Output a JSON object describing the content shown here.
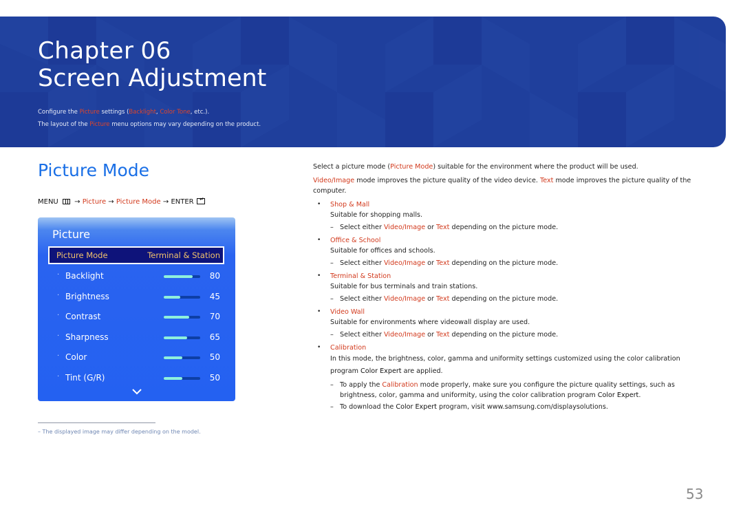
{
  "banner": {
    "chapter_label": "Chapter",
    "chapter_number": "06",
    "title": "Screen Adjustment",
    "desc1": {
      "p1": "Configure the ",
      "h1": "Picture",
      "p2": " settings (",
      "h2": "Backlight",
      "p3": ", ",
      "h3": "Color Tone",
      "p4": ", etc.)."
    },
    "desc2": {
      "p1": "The layout of the ",
      "h1": "Picture",
      "p2": " menu options may vary depending on the product."
    }
  },
  "section": {
    "title": "Picture Mode",
    "menu_path": {
      "menu": "MENU",
      "arrow": "→",
      "step1": "Picture",
      "step2": "Picture Mode",
      "enter": "ENTER"
    }
  },
  "osd": {
    "title": "Picture",
    "selected": {
      "label": "Picture Mode",
      "value": "Terminal & Station"
    },
    "rows": [
      {
        "label": "Backlight",
        "value": "80",
        "level": 80
      },
      {
        "label": "Brightness",
        "value": "45",
        "level": 45
      },
      {
        "label": "Contrast",
        "value": "70",
        "level": 70
      },
      {
        "label": "Sharpness",
        "value": "65",
        "level": 65
      },
      {
        "label": "Color",
        "value": "50",
        "level": 50
      },
      {
        "label": "Tint (G/R)",
        "value": "50",
        "level": 50
      }
    ],
    "bullet": "·",
    "colors": {
      "fill": "#8ef0dc",
      "track": "#0d3fa6",
      "highlight": "#f2c36b"
    }
  },
  "footnote": "–  The displayed image may differ depending on the model.",
  "right": {
    "intro": {
      "p1": "Select a picture mode (",
      "h1": "Picture Mode",
      "p2": ") suitable for the environment where the product will be used."
    },
    "intro2": {
      "h1": "Video/Image",
      "p1": " mode improves the picture quality of the video device. ",
      "h2": "Text",
      "p2": " mode improves the picture quality of the computer."
    },
    "note_parts": {
      "p1": "Select either ",
      "h1": "Video/Image",
      "p2": " or ",
      "h2": "Text",
      "p3": " depending on the picture mode."
    },
    "items": [
      {
        "head": "Shop & Mall",
        "desc": "Suitable for shopping malls."
      },
      {
        "head": "Office & School",
        "desc": "Suitable for offices and schools."
      },
      {
        "head": "Terminal & Station",
        "desc": "Suitable for bus terminals and train stations."
      },
      {
        "head": "Video Wall",
        "desc": "Suitable for environments where videowall display are used."
      }
    ],
    "calibration": {
      "head": "Calibration",
      "desc1": "In this mode, the brightness, color, gamma and uniformity settings customized using the color calibration",
      "desc2a": "program ",
      "desc2b": "Color Expert",
      "desc2c": " are applied.",
      "note1a": "To apply the ",
      "note1b": "Calibration",
      "note1c": " mode properly, make sure you configure the picture quality settings, such as brightness, color, gamma and uniformity, using the color calibration program ",
      "note1d": "Color Expert",
      "note1e": ".",
      "note2a": "To download the ",
      "note2b": "Color Expert",
      "note2c": " program, visit www.samsung.com/displaysolutions."
    },
    "bullet": "•",
    "dash": "–"
  },
  "page_number": "53"
}
